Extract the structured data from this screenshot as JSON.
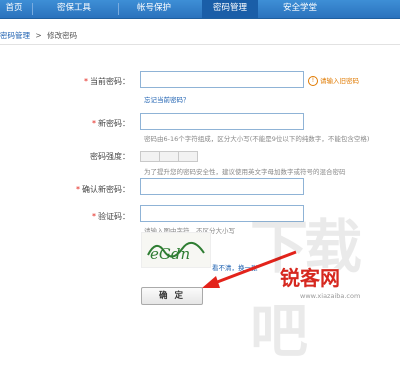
{
  "nav": {
    "items": [
      {
        "label": "首页"
      },
      {
        "label": "密保工具"
      },
      {
        "label": "帐号保护"
      },
      {
        "label": "密码管理"
      },
      {
        "label": "安全学堂"
      }
    ]
  },
  "breadcrumb": {
    "parent": "密码管理",
    "separator": ">",
    "current": "修改密码"
  },
  "form": {
    "current_password_label": "当前密码：",
    "current_password_warning": "请输入旧密码",
    "forgot_link": "忘记当前密码？",
    "new_password_label": "新密码：",
    "new_password_hint": "密码由6-16个字符组成，区分大小写(不能是9位以下的纯数字，不能包含空格)",
    "strength_label": "密码强度：",
    "strength_hint": "为了提升您的密码安全性，建议使用英文字母加数字或符号的混合密码",
    "confirm_label": "确认新密码：",
    "captcha_label": "验证码：",
    "captcha_hint": "请输入图中字符，不区分大小写",
    "captcha_text": "eGdn",
    "captcha_refresh": "看不清，换一张",
    "submit_label": "确 定",
    "star": "*"
  },
  "watermark": {
    "brand": "锐客网",
    "bg": "下载吧",
    "url": "www.xiazaiba.com"
  },
  "colors": {
    "nav": "#2a72bd",
    "active": "#1a5ea8",
    "link": "#1b5fb0",
    "warning": "#e07a00",
    "required": "#e3231b"
  }
}
